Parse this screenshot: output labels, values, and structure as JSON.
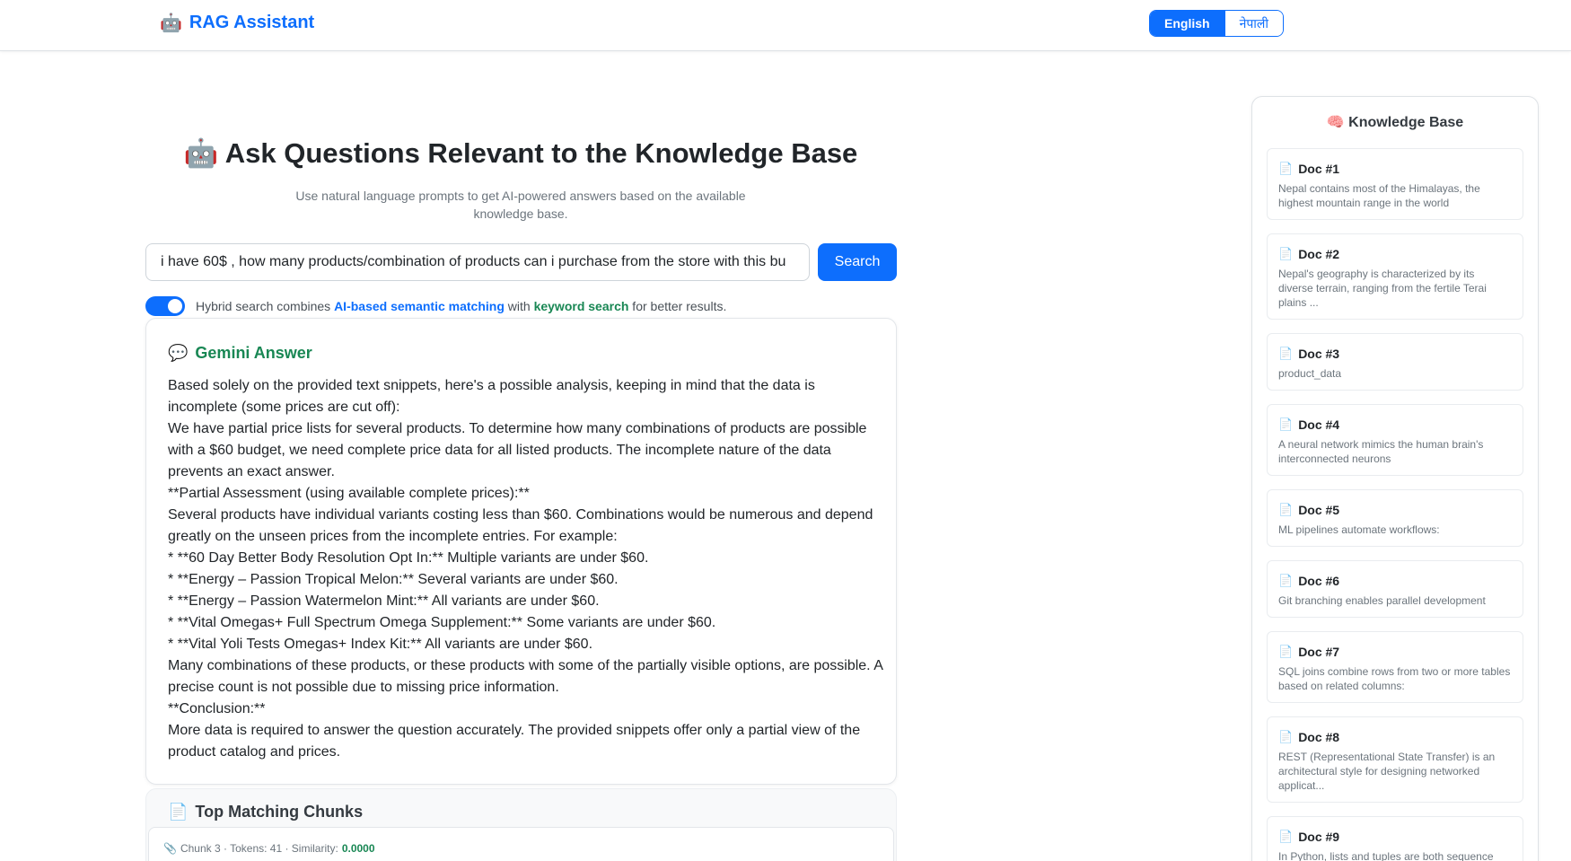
{
  "navbar": {
    "brand_icon": "robot-icon",
    "brand": "RAG Assistant",
    "languages": [
      {
        "label": "English",
        "active": true
      },
      {
        "label": "नेपाली",
        "active": false
      }
    ]
  },
  "main": {
    "title": "🤖 Ask Questions Relevant to the Knowledge Base",
    "subtitle": "Use natural language prompts to get AI-powered answers based on the available knowledge base.",
    "search": {
      "value": "i have 60$ , how many products/combination of products can i purchase from the store with this bu",
      "button": "Search"
    },
    "hybrid": {
      "enabled": true,
      "prefix": "Hybrid search combines ",
      "semantic": "AI-based semantic matching",
      "middle": " with ",
      "keyword": "keyword search",
      "suffix": " for better results."
    },
    "answer": {
      "icon": "speech-bubble-icon",
      "title": "Gemini Answer",
      "lines": [
        "Based solely on the provided text snippets, here's a possible analysis, keeping in mind that the data is incomplete (some prices are cut off):",
        "We have partial price lists for several products. To determine how many combinations of products are possible with a $60 budget, we need complete price data for all listed products. The incomplete nature of the data prevents an exact answer.",
        "**Partial Assessment (using available complete prices):**",
        "Several products have individual variants costing less than $60. Combinations would be numerous and depend greatly on the unseen prices from the incomplete entries. For example:",
        "* **60 Day Better Body Resolution Opt In:** Multiple variants are under $60.",
        "* **Energy – Passion Tropical Melon:** Several variants are under $60.",
        "* **Energy – Passion Watermelon Mint:** All variants are under $60.",
        "* **Vital Omegas+ Full Spectrum Omega Supplement:** Some variants are under $60.",
        "* **Vital Yoli Tests Omegas+ Index Kit:** All variants are under $60.",
        "Many combinations of these products, or these products with some of the partially visible options, are possible. A precise count is not possible due to missing price information.",
        "**Conclusion:**",
        "More data is required to answer the question accurately. The provided snippets offer only a partial view of the product catalog and prices."
      ]
    },
    "chunks": {
      "title": "Top Matching Chunks",
      "items": [
        {
          "label": "Chunk 3 · Tokens: 41 · Similarity:",
          "similarity": "0.0000"
        }
      ]
    }
  },
  "knowledge_base": {
    "title": "🧠 Knowledge Base",
    "docs": [
      {
        "title": "Doc #1",
        "desc": "Nepal contains most of the Himalayas, the highest mountain range in the world"
      },
      {
        "title": "Doc #2",
        "desc": "Nepal's geography is characterized by its diverse terrain, ranging from the fertile Terai plains ..."
      },
      {
        "title": "Doc #3",
        "desc": "product_data"
      },
      {
        "title": "Doc #4",
        "desc": "A neural network mimics the human brain's interconnected neurons"
      },
      {
        "title": "Doc #5",
        "desc": "ML pipelines automate workflows:"
      },
      {
        "title": "Doc #6",
        "desc": "Git branching enables parallel development"
      },
      {
        "title": "Doc #7",
        "desc": "SQL joins combine rows from two or more tables based on related columns:"
      },
      {
        "title": "Doc #8",
        "desc": "REST (Representational State Transfer) is an architectural style for designing networked applicat..."
      },
      {
        "title": "Doc #9",
        "desc": "In Python, lists and tuples are both sequence"
      }
    ]
  },
  "colors": {
    "primary": "#0d6efd",
    "success": "#198754",
    "muted": "#6c757d"
  }
}
